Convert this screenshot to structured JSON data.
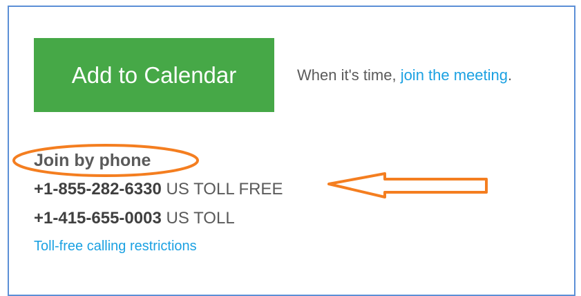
{
  "calendar": {
    "button_label": "Add to Calendar"
  },
  "meeting": {
    "prefix": "When it's time, ",
    "link": "join the meeting",
    "suffix": "."
  },
  "phone": {
    "heading": "Join by phone",
    "numbers": [
      {
        "number": "+1-855-282-6330",
        "type": " US TOLL FREE"
      },
      {
        "number": "+1-415-655-0003",
        "type": " US TOLL"
      }
    ],
    "restrictions_link": "Toll-free calling restrictions"
  },
  "annotations": {
    "color": "#f47e20",
    "shapes": [
      "ellipse-highlight",
      "arrow-left"
    ]
  },
  "colors": {
    "button": "#46a847",
    "link": "#1ba1e2",
    "frame_border": "#5b8fd6"
  }
}
